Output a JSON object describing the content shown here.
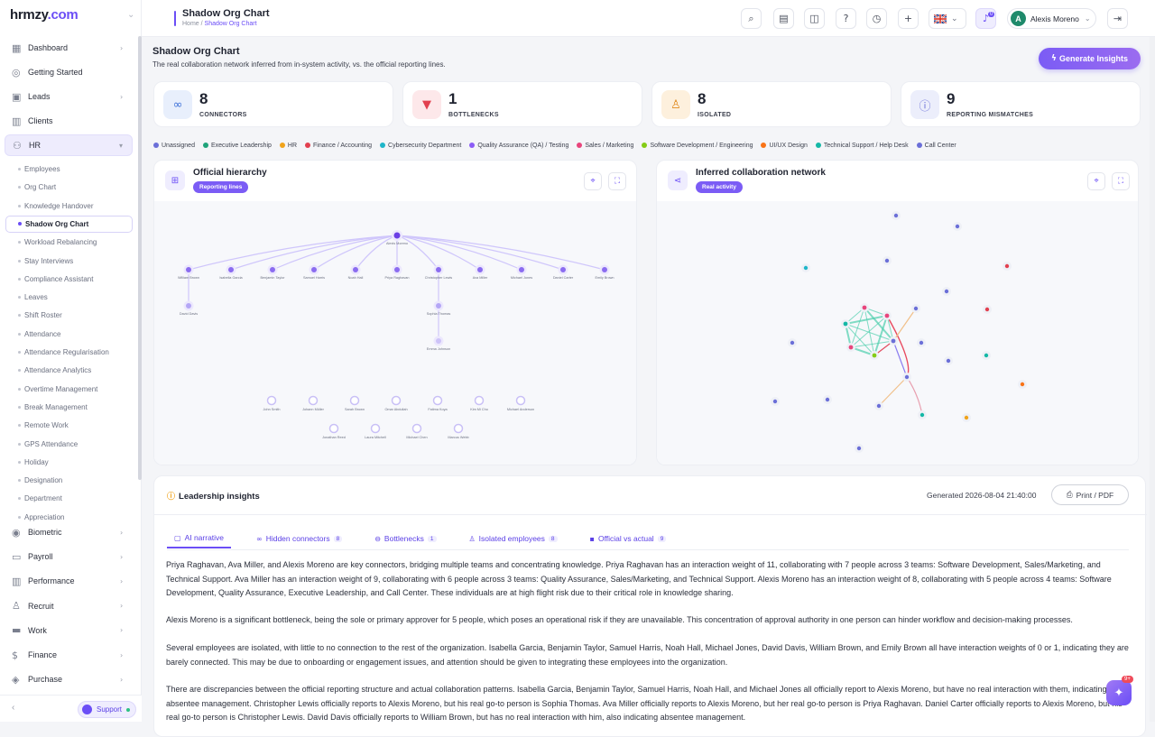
{
  "brand": {
    "logo_left": "hr",
    "logo_mid": "m",
    "logo_right": "zy",
    "logo_tld": ".com"
  },
  "sidebar": {
    "items": [
      {
        "label": "Dashboard",
        "icon": "grid-icon",
        "chev": "›"
      },
      {
        "label": "Getting Started",
        "icon": "check-circle-icon",
        "chev": ""
      },
      {
        "label": "Leads",
        "icon": "id-card-icon",
        "chev": "›"
      },
      {
        "label": "Clients",
        "icon": "chart-icon",
        "chev": ""
      },
      {
        "label": "HR",
        "icon": "people-icon",
        "chev": "▾"
      }
    ],
    "sub": [
      "Employees",
      "Org Chart",
      "Knowledge Handover",
      "Shadow Org Chart",
      "Workload Rebalancing",
      "Stay Interviews",
      "Compliance Assistant",
      "Leaves",
      "Shift Roster",
      "Attendance",
      "Attendance Regularisation",
      "Attendance Analytics",
      "Overtime Management",
      "Break Management",
      "Remote Work",
      "GPS Attendance",
      "Holiday",
      "Designation",
      "Department",
      "Appreciation"
    ],
    "bottom": [
      {
        "label": "Biometric",
        "icon": "fingerprint-icon"
      },
      {
        "label": "Payroll",
        "icon": "wallet-icon"
      },
      {
        "label": "Performance",
        "icon": "bar-chart-icon"
      },
      {
        "label": "Recruit",
        "icon": "recruit-icon"
      },
      {
        "label": "Work",
        "icon": "briefcase-icon"
      },
      {
        "label": "Finance",
        "icon": "dollar-icon"
      },
      {
        "label": "Purchase",
        "icon": "layers-icon"
      }
    ],
    "support": "Support",
    "collapse": "‹"
  },
  "topbar": {
    "title": "Shadow Org Chart",
    "crumb_home": "Home",
    "crumb_sep": "/",
    "crumb_current": "Shadow Org Chart",
    "user": "Alexis Moreno",
    "avatar": "A",
    "notif": "0"
  },
  "page": {
    "title": "Shadow Org Chart",
    "subtitle": "The real collaboration network inferred from in-system activity, vs. the official reporting lines.",
    "generate": "Generate Insights"
  },
  "stats": [
    {
      "value": "8",
      "label": "CONNECTORS",
      "color": "#3b6fd8",
      "bg": "#e8effc",
      "icon": "link-icon"
    },
    {
      "value": "1",
      "label": "BOTTLENECKS",
      "color": "#e2404f",
      "bg": "#fde8ea",
      "icon": "funnel-icon"
    },
    {
      "value": "8",
      "label": "ISOLATED",
      "color": "#e08a1e",
      "bg": "#fdf0dd",
      "icon": "user-x-icon"
    },
    {
      "value": "9",
      "label": "REPORTING MISMATCHES",
      "color": "#6b6fd8",
      "bg": "#eceefb",
      "icon": "alert-circle-icon"
    }
  ],
  "legend": [
    {
      "label": "Unassigned",
      "color": "#6b6fd8"
    },
    {
      "label": "Executive Leadership",
      "color": "#1fa37a"
    },
    {
      "label": "HR",
      "color": "#f0a31b"
    },
    {
      "label": "Finance / Accounting",
      "color": "#e2404f"
    },
    {
      "label": "Cybersecurity Department",
      "color": "#1fb6c9"
    },
    {
      "label": "Quality Assurance (QA) / Testing",
      "color": "#8b5cf6"
    },
    {
      "label": "Sales / Marketing",
      "color": "#e8457c"
    },
    {
      "label": "Software Development / Engineering",
      "color": "#84cc16"
    },
    {
      "label": "UI/UX Design",
      "color": "#f97316"
    },
    {
      "label": "Technical Support / Help Desk",
      "color": "#14b8a6"
    },
    {
      "label": "Call Center",
      "color": "#6b6fd8"
    }
  ],
  "panels": {
    "left": {
      "title": "Official hierarchy",
      "badge": "Reporting lines",
      "icon": "hierarchy-icon"
    },
    "right": {
      "title": "Inferred collaboration network",
      "badge": "Real activity",
      "icon": "share-icon"
    }
  },
  "hierarchy": {
    "root": "Alexis Moreno",
    "level1": [
      "William Brown",
      "Isabella Garcia",
      "Benjamin Taylor",
      "Samuel Harris",
      "Noah Hall",
      "Priya Raghavan",
      "Christopher Lewis",
      "Ava Miller",
      "Michael Jones",
      "Daniel Carter",
      "Emily Brown"
    ],
    "under_william": "David Davis",
    "under_christopher": "Sophia Thomas",
    "under_sophia": "Emma Johnson",
    "unassigned_row1": [
      "John Smith",
      "Johann Müller",
      "Sarah Brown",
      "Omar Abdullah",
      "Fatima Koya",
      "Kim Mi Cho",
      "Michael Anderson"
    ],
    "unassigned_row2": [
      "Jonathan Reed",
      "Laura Mitchell",
      "Michael Chen",
      "Marcus Webb"
    ]
  },
  "insights": {
    "title": "Leadership insights",
    "generated": "Generated 2026-08-04 21:40:00",
    "print": "Print / PDF",
    "tabs": [
      {
        "label": "AI narrative",
        "count": "",
        "icon": "book-icon"
      },
      {
        "label": "Hidden connectors",
        "count": "8",
        "icon": "link-icon"
      },
      {
        "label": "Bottlenecks",
        "count": "1",
        "icon": "stop-icon"
      },
      {
        "label": "Isolated employees",
        "count": "8",
        "icon": "person-icon"
      },
      {
        "label": "Official vs actual",
        "count": "9",
        "icon": "compare-icon"
      }
    ],
    "paragraphs": [
      "Priya Raghavan, Ava Miller, and Alexis Moreno are key connectors, bridging multiple teams and concentrating knowledge. Priya Raghavan has an interaction weight of 11, collaborating with 7 people across 3 teams: Software Development, Sales/Marketing, and Technical Support. Ava Miller has an interaction weight of 9, collaborating with 6 people across 3 teams: Quality Assurance, Sales/Marketing, and Technical Support. Alexis Moreno has an interaction weight of 8, collaborating with 5 people across 4 teams: Software Development, Quality Assurance, Executive Leadership, and Call Center. These individuals are at high flight risk due to their critical role in knowledge sharing.",
      "Alexis Moreno is a significant bottleneck, being the sole or primary approver for 5 people, which poses an operational risk if they are unavailable. This concentration of approval authority in one person can hinder workflow and decision-making processes.",
      "Several employees are isolated, with little to no connection to the rest of the organization. Isabella Garcia, Benjamin Taylor, Samuel Harris, Noah Hall, Michael Jones, David Davis, William Brown, and Emily Brown all have interaction weights of 0 or 1, indicating they are barely connected. This may be due to onboarding or engagement issues, and attention should be given to integrating these employees into the organization.",
      "There are discrepancies between the official reporting structure and actual collaboration patterns. Isabella Garcia, Benjamin Taylor, Samuel Harris, Noah Hall, and Michael Jones all officially report to Alexis Moreno, but have no real interaction with them, indicating absentee management. Christopher Lewis officially reports to Alexis Moreno, but his real go-to person is Sophia Thomas. Ava Miller officially reports to Alexis Moreno, but her real go-to person is Priya Raghavan. Daniel Carter officially reports to Alexis Moreno, but his real go-to person is Christopher Lewis. David Davis officially reports to William Brown, but has no real interaction with him, also indicating absentee management."
    ]
  },
  "fab": {
    "badge": "9+"
  }
}
